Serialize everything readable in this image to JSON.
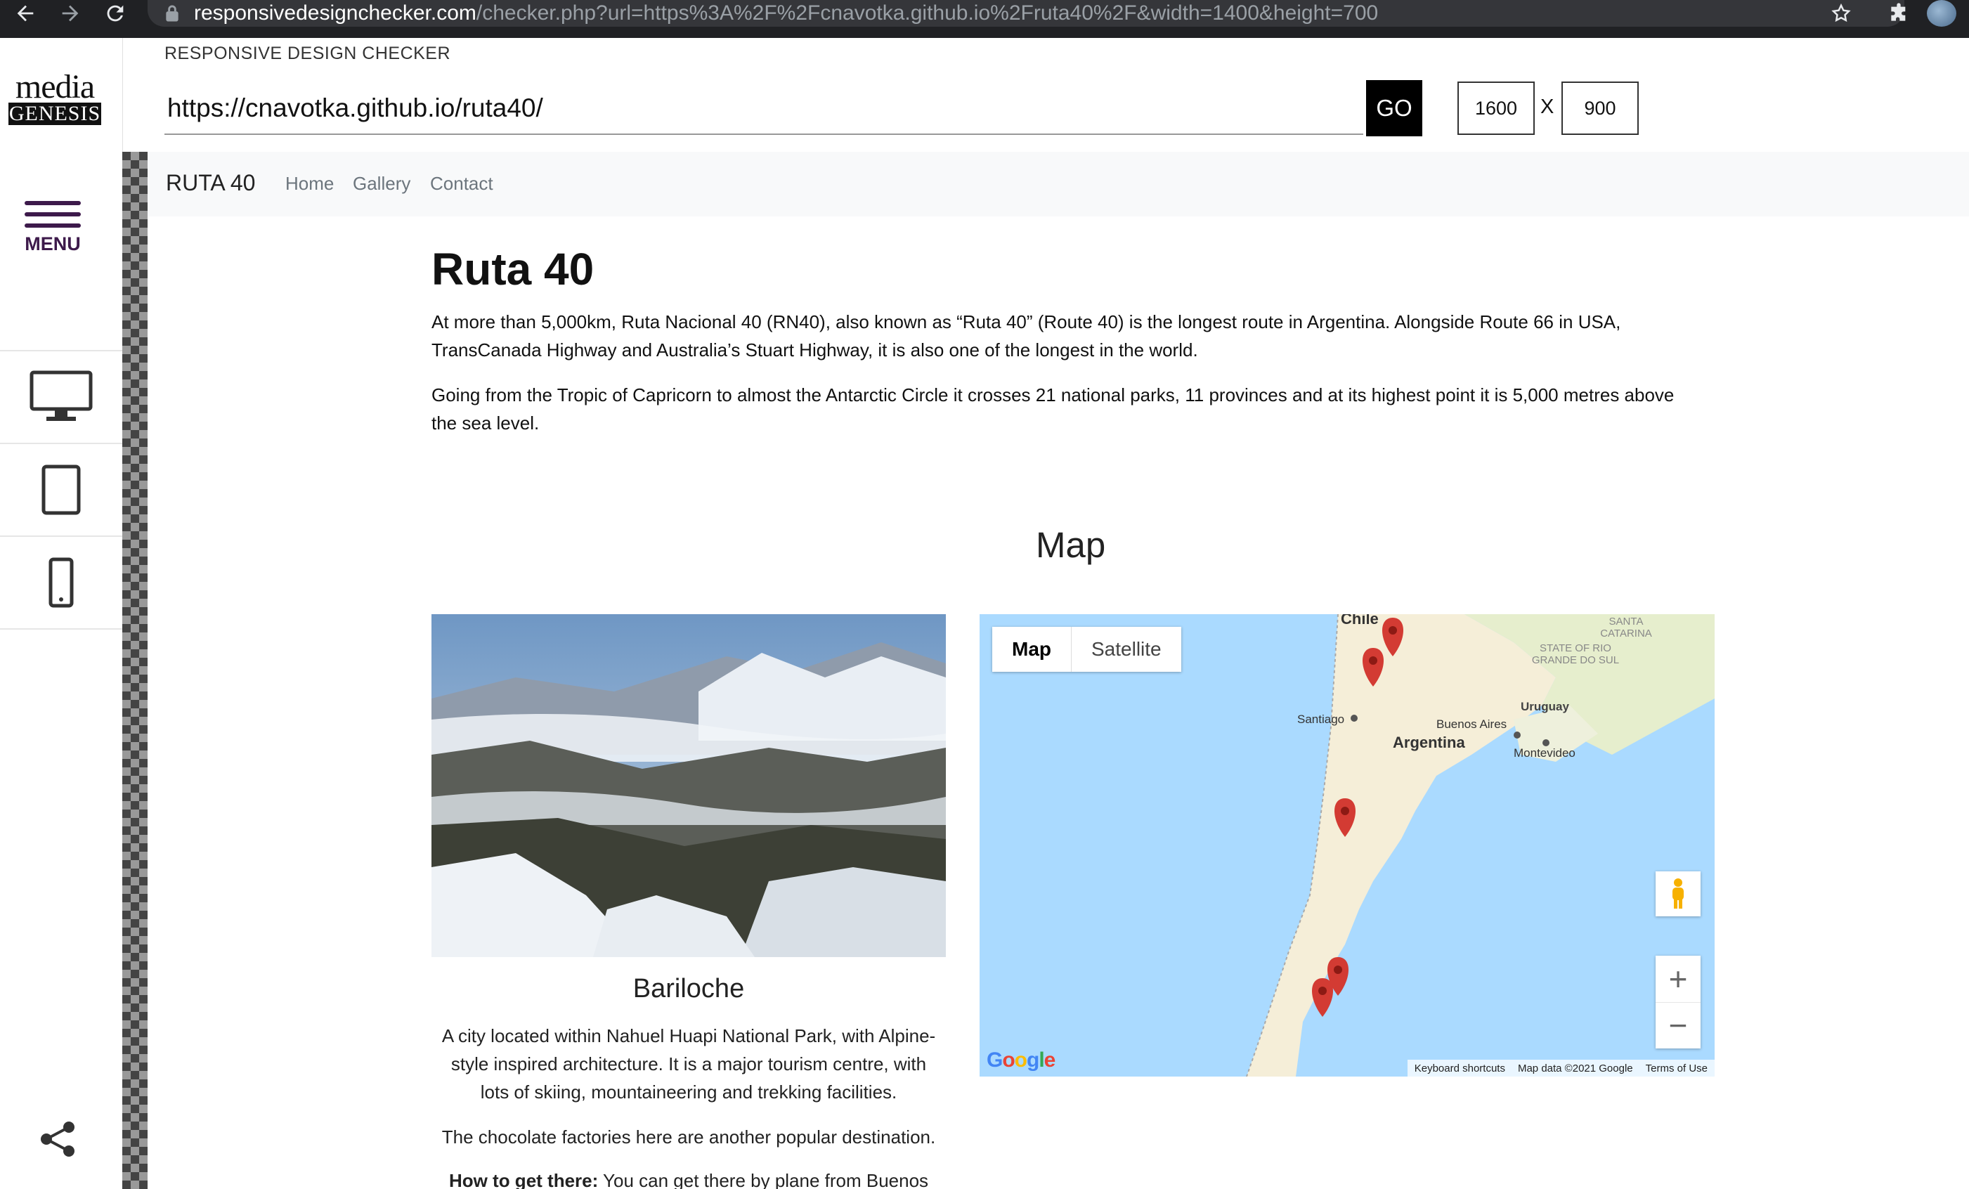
{
  "browser": {
    "url_host": "responsivedesignchecker.com",
    "url_path": "/checker.php?url=https%3A%2F%2Fcnavotka.github.io%2Fruta40%2F&width=1400&height=700"
  },
  "sidebar": {
    "logo_top": "media",
    "logo_bottom": "GENESIS",
    "menu_label": "MENU"
  },
  "checker": {
    "title": "RESPONSIVE DESIGN CHECKER",
    "url_value": "https://cnavotka.github.io/ruta40/",
    "go_label": "GO",
    "width_value": "1600",
    "x_label": "X",
    "height_value": "900"
  },
  "site": {
    "brand": "RUTA 40",
    "nav": [
      "Home",
      "Gallery",
      "Contact"
    ],
    "title": "Ruta 40",
    "para1_line1": "At more than 5,000km, Ruta Nacional 40 (RN40), also known as “Ruta 40” (Route 40) is the longest route in Argentina. Alongside Route 66 in USA,",
    "para1_line2": "TransCanada Highway and Australia’s Stuart Highway, it is also one of the longest in the world.",
    "para2_line1": "Going from the Tropic of Capricorn to almost the Antarctic Circle it crosses 21 national parks, 11 provinces and at its highest point it is 5,000 metres above",
    "para2_line2": "the sea level.",
    "map_heading": "Map",
    "card": {
      "title": "Bariloche",
      "text_line1": "A city located within Nahuel Huapi National Park, with Alpine-",
      "text_line2": "style inspired architecture. It is a major tourism centre, with",
      "text_line3": "lots of skiing, mountaineering and trekking facilities.",
      "text2": "The chocolate factories here are another popular destination.",
      "howto_label": "How to get there:",
      "howto_text": " You can get there by plane from Buenos"
    },
    "map": {
      "tab_map": "Map",
      "tab_satellite": "Satellite",
      "labels": {
        "chile": "Chile",
        "santa_catarina": "SANTA CATARINA",
        "rio_grande": "STATE OF RIO GRANDE DO SUL",
        "uruguay": "Uruguay",
        "santiago": "Santiago",
        "buenos_aires": "Buenos Aires",
        "argentina": "Argentina",
        "montevideo": "Montevideo"
      },
      "google": "Google",
      "footer": [
        "Keyboard shortcuts",
        "Map data ©2021 Google",
        "Terms of Use"
      ],
      "zoom_in": "+",
      "zoom_out": "−"
    }
  },
  "colors": {
    "browser_bg": "#202124",
    "brand_purple": "#3d1a4b",
    "water": "#aadaff",
    "land": "#f5eed8",
    "marker": "#d33b33"
  },
  "icons": [
    "back-arrow-icon",
    "forward-arrow-icon",
    "reload-icon",
    "lock-icon",
    "star-icon",
    "puzzle-icon",
    "desktop-icon",
    "tablet-icon",
    "phone-icon",
    "share-icon",
    "pegman-icon",
    "map-marker-icon"
  ]
}
